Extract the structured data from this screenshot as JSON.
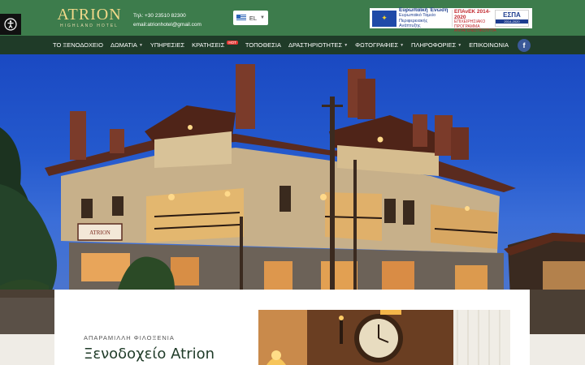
{
  "header": {
    "logo_main": "ATRION",
    "logo_sub": "HIGHLAND HOTEL",
    "phone": "Τηλ: +30 23510 82300",
    "email": "email:atrionhotel@gmail.com",
    "language": "EL"
  },
  "espa": {
    "eu_title": "Ευρωπαϊκή Ένωση",
    "eu_line1": "Ευρωπαϊκό Ταμείο",
    "eu_line2": "Περιφερειακής Ανάπτυξης",
    "epanek_title": "ΕΠΑνΕΚ 2014-2020",
    "epanek_line1": "ΕΠΙΧΕΙΡΗΣΙΑΚΟ ΠΡΟΓΡΑΜΜΑ",
    "epanek_line2": "ΑΝΤΑΓΩΝΙΣΤΙΚΟΤΗΤΑ",
    "espa_title": "ΕΣΠΑ",
    "espa_years": "2014-2020"
  },
  "nav": {
    "items": [
      {
        "label": "ΤΟ ΞΕΝΟΔΟΧΕΙΟ"
      },
      {
        "label": "ΔΩΜΑΤΙΑ"
      },
      {
        "label": "ΥΠΗΡΕΣΙΕΣ"
      },
      {
        "label": "ΚΡΑΤΗΣΕΙΣ"
      },
      {
        "label": "ΤΟΠΟΘΕΣΙΑ"
      },
      {
        "label": "ΔΡΑΣΤΗΡΙΟΤΗΤΕΣ"
      },
      {
        "label": "ΦΩΤΟΓΡΑΦΙΕΣ"
      },
      {
        "label": "ΠΛΗΡΟΦΟΡΙΕΣ"
      },
      {
        "label": "ΕΠΙΚΟΙΝΩΝΙΑ"
      }
    ],
    "hot_badge": "HOT",
    "facebook": "f"
  },
  "intro": {
    "subtitle": "ΑΠΑΡΑΜΙΛΛΗ ΦΙΛΟΞΕΝΙΑ",
    "title": "Ξενοδοχείο Atrion"
  },
  "hero": {
    "sign_text": "ATRION"
  },
  "icons": {
    "accessibility": "accessibility-icon",
    "flag": "greek-flag-icon",
    "facebook": "facebook-icon"
  }
}
